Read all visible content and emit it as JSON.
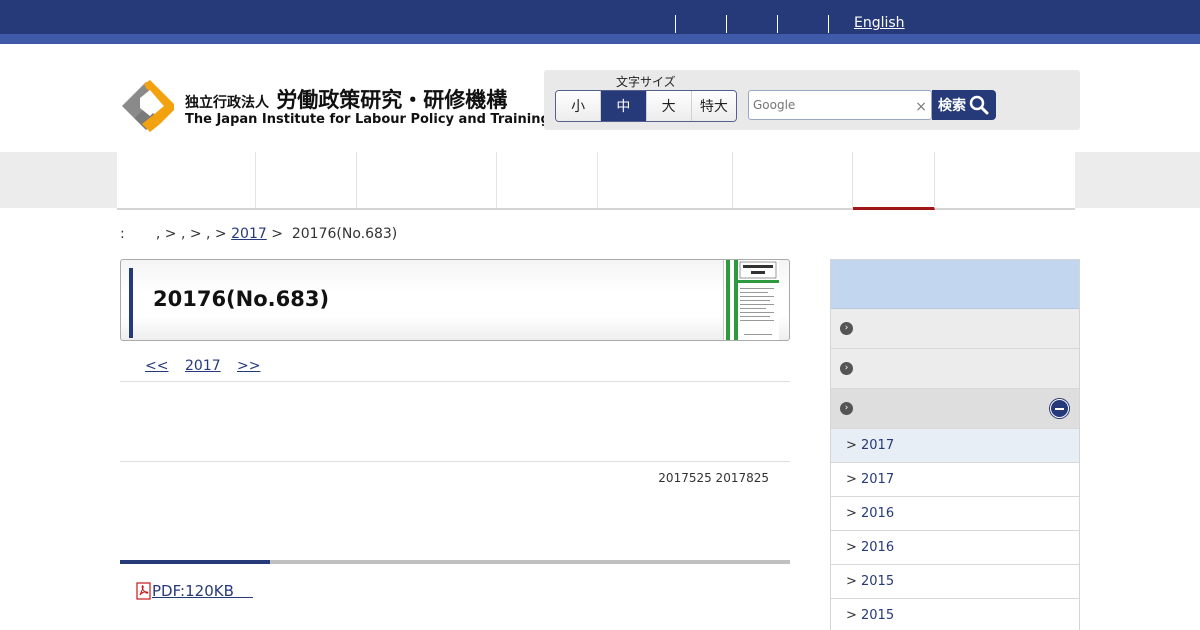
{
  "top_bar": {
    "english_link": "English"
  },
  "header": {
    "logo_jp_small": "独立行政法人",
    "logo_jp_main": "労働政策研究・研修機構",
    "logo_en": "The Japan Institute for Labour Policy and Training",
    "font_size_label": "文字サイズ",
    "font_sizes": [
      "小",
      "中",
      "大",
      "特大"
    ],
    "font_size_selected": "中",
    "search_placeholder": "Google",
    "search_clear": "×",
    "search_button": "検索"
  },
  "breadcrumb": {
    "prefix": ":",
    "seg1": "       , > , > , >",
    "year_link": "2017",
    "current": ">  20176(No.683)"
  },
  "article": {
    "title": "20176(No.683)",
    "pager_prev": "<<",
    "pager_year": "2017",
    "pager_next": ">>",
    "dates": "2017525 2017825",
    "pdf_link": "PDF:120KB    "
  },
  "sidebar": {
    "sub_items": [
      "2017",
      "2017",
      "2016",
      "2016",
      "2015",
      "2015"
    ],
    "chevron": ">"
  },
  "colors": {
    "navy": "#263979",
    "accent_red": "#a01515",
    "sidebar_head": "#c2d7ef"
  }
}
